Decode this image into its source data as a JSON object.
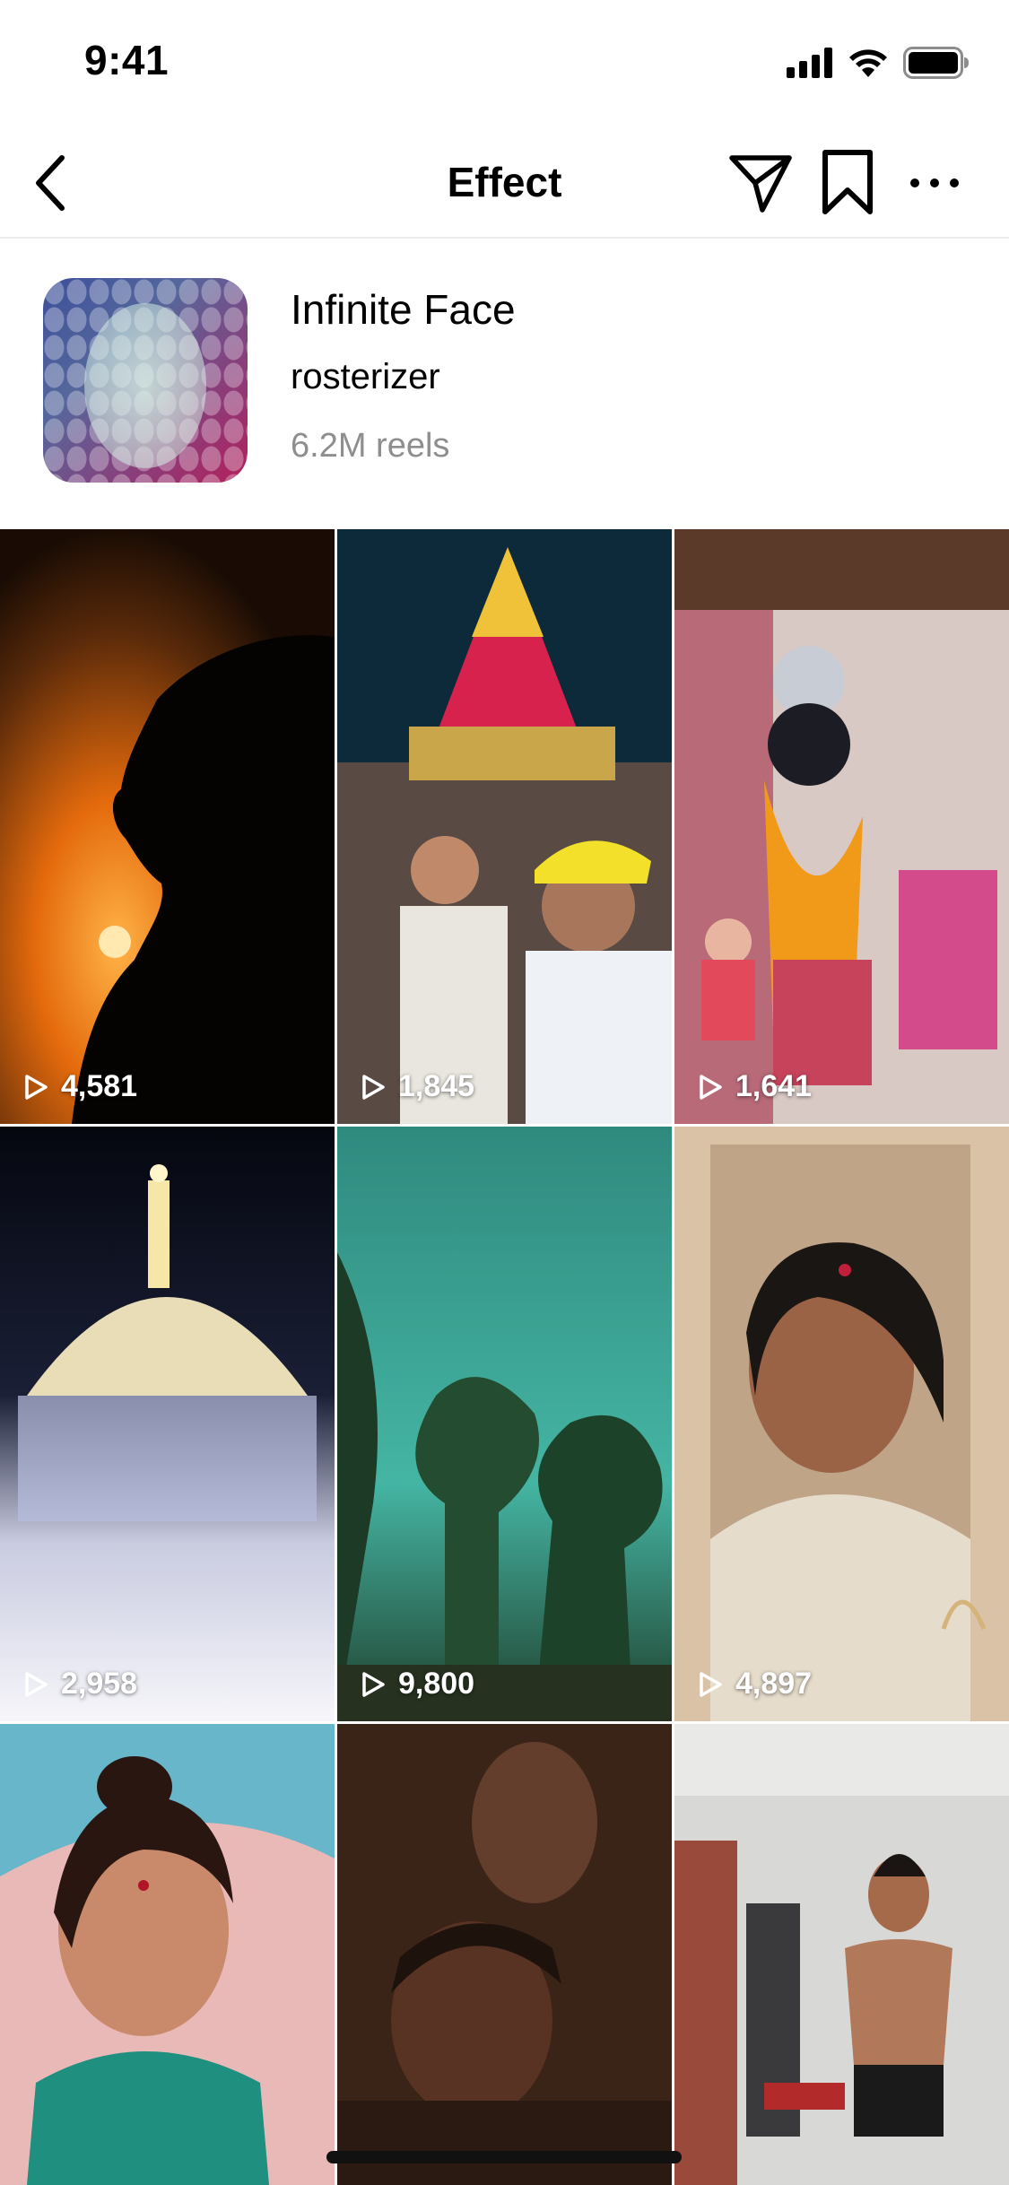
{
  "status_bar": {
    "time": "9:41"
  },
  "nav": {
    "title": "Effect"
  },
  "effect": {
    "name": "Infinite Face",
    "creator": "rosterizer",
    "reels_count": "6.2M reels"
  },
  "reels": [
    {
      "plays": "4,581",
      "scene": "silhouette-sunset"
    },
    {
      "plays": "1,845",
      "scene": "temple-festival-selfie"
    },
    {
      "plays": "1,641",
      "scene": "goddess-idol"
    },
    {
      "plays": "2,958",
      "scene": "illuminated-dome"
    },
    {
      "plays": "9,800",
      "scene": "trees-green-sky"
    },
    {
      "plays": "4,897",
      "scene": "woman-portrait"
    },
    {
      "plays": "",
      "scene": "woman-selfie-teal"
    },
    {
      "plays": "",
      "scene": "dim-faces"
    },
    {
      "plays": "",
      "scene": "gym-man"
    }
  ],
  "icons": {
    "back": "chevron-left-icon",
    "send": "paper-plane-icon",
    "save": "bookmark-icon",
    "more": "more-horizontal-icon",
    "play": "play-outline-icon"
  }
}
